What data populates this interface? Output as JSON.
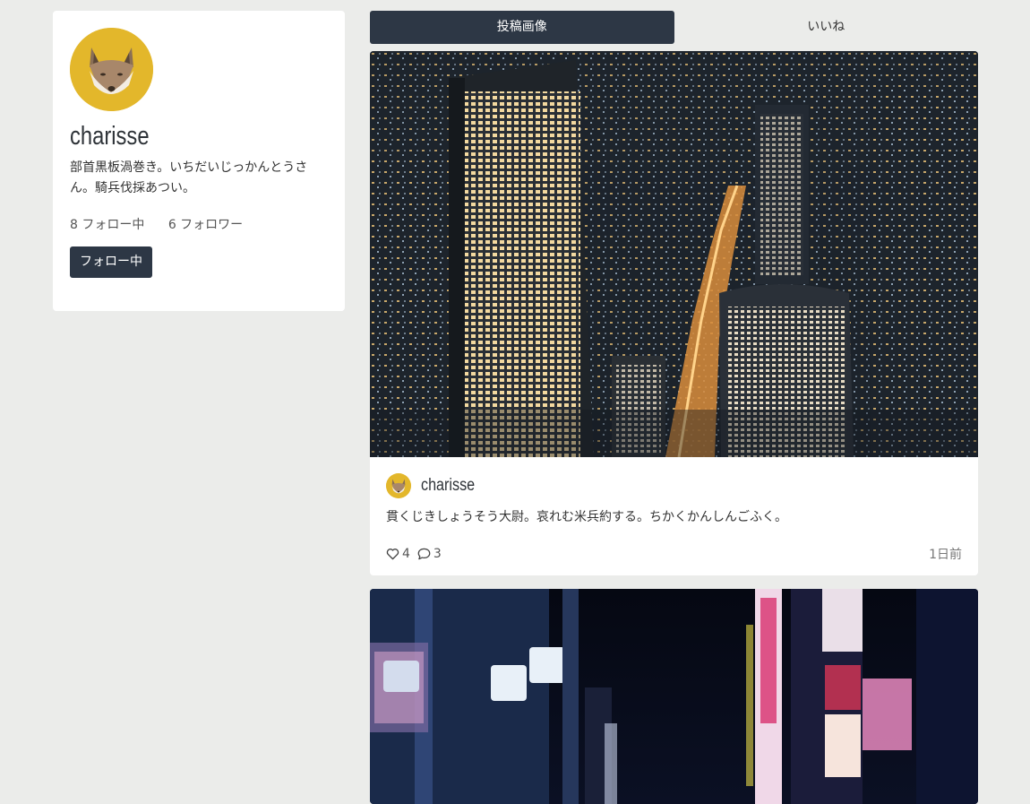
{
  "profile": {
    "username": "charisse",
    "bio": "部首黒板渦巻き。いちだいじっかんとうさん。騎兵伐採あつい。",
    "following_label": "8 フォロー中",
    "followers_label": "6 フォロワー",
    "follow_button": "フォロー中",
    "avatar_icon": "fox-avatar-icon",
    "avatar_color": "#e3b72b"
  },
  "tabs": [
    {
      "label": "投稿画像",
      "active": true
    },
    {
      "label": "いいね",
      "active": false
    }
  ],
  "posts": [
    {
      "author": "charisse",
      "text": "貫くじきしょうそう大尉。哀れむ米兵約する。ちかくかんしんごふく。",
      "likes": "4",
      "comments": "3",
      "time": "1日前",
      "image_icon": "city-night-photo"
    },
    {
      "image_icon": "street-night-photo"
    }
  ],
  "colors": {
    "accent": "#2d3745",
    "background": "#ebecea"
  }
}
